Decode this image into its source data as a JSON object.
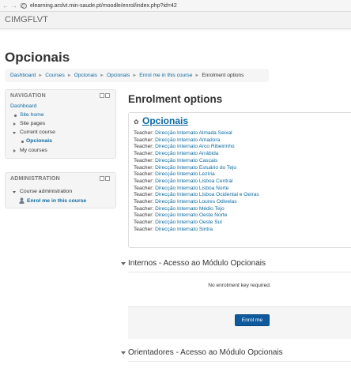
{
  "browser": {
    "back": "←",
    "forward": "→",
    "reload": "C",
    "info": "i",
    "url": "elearning.arslvt.min-saude.pt/moodle/enrol/index.php?id=42"
  },
  "site": {
    "name": "CIMGFLVT"
  },
  "page": {
    "title": "Opcionais"
  },
  "breadcrumb": [
    {
      "label": "Dashboard"
    },
    {
      "label": "Courses"
    },
    {
      "label": "Opcionais"
    },
    {
      "label": "Opcionais"
    },
    {
      "label": "Enrol me in this course"
    },
    {
      "label": "Enrolment options"
    }
  ],
  "breadcrumb_sep": "►",
  "navigation": {
    "title": "NAVIGATION",
    "dashboard": "Dashboard",
    "site_home": "Site home",
    "site_pages": "Site pages",
    "current_course": "Current course",
    "current_course_item": "Opcionais",
    "my_courses": "My courses"
  },
  "administration": {
    "title": "ADMINISTRATION",
    "course_admin": "Course administration",
    "enrol_link": "Enrol me in this course"
  },
  "main": {
    "heading": "Enrolment options",
    "course_title": "Opcionais",
    "teacher_label": "Teacher:",
    "teachers": [
      "Direcção Internato Almada Seixal",
      "Direcção Internato Amadora",
      "Direcção Internato Arco Ribeirinho",
      "Direcção Internato Arrábida",
      "Direcção Internato Cascais",
      "Direcção Internato Estuário do Tejo",
      "Direcção Internato Lezíria",
      "Direcção Internato Lisboa Central",
      "Direcção Internato Lisboa Norte",
      "Direcção Internato Lisboa Ocidental e Oeiras",
      "Direcção Internato Loures Odivelas",
      "Direcção Internato Médio Tejo",
      "Direcção Internato Oeste Norte",
      "Direcção Internato Oeste Sul",
      "Direcção Internato Sintra"
    ],
    "section1_title": "Internos - Acesso ao Módulo Opcionais",
    "no_key_text": "No enrolment key required.",
    "enrol_button": "Enrol me",
    "section2_title": "Orientadores - Acesso ao Módulo Opcionais"
  },
  "colors": {
    "link": "#0b6aa2",
    "button": "#0e5a9d"
  }
}
